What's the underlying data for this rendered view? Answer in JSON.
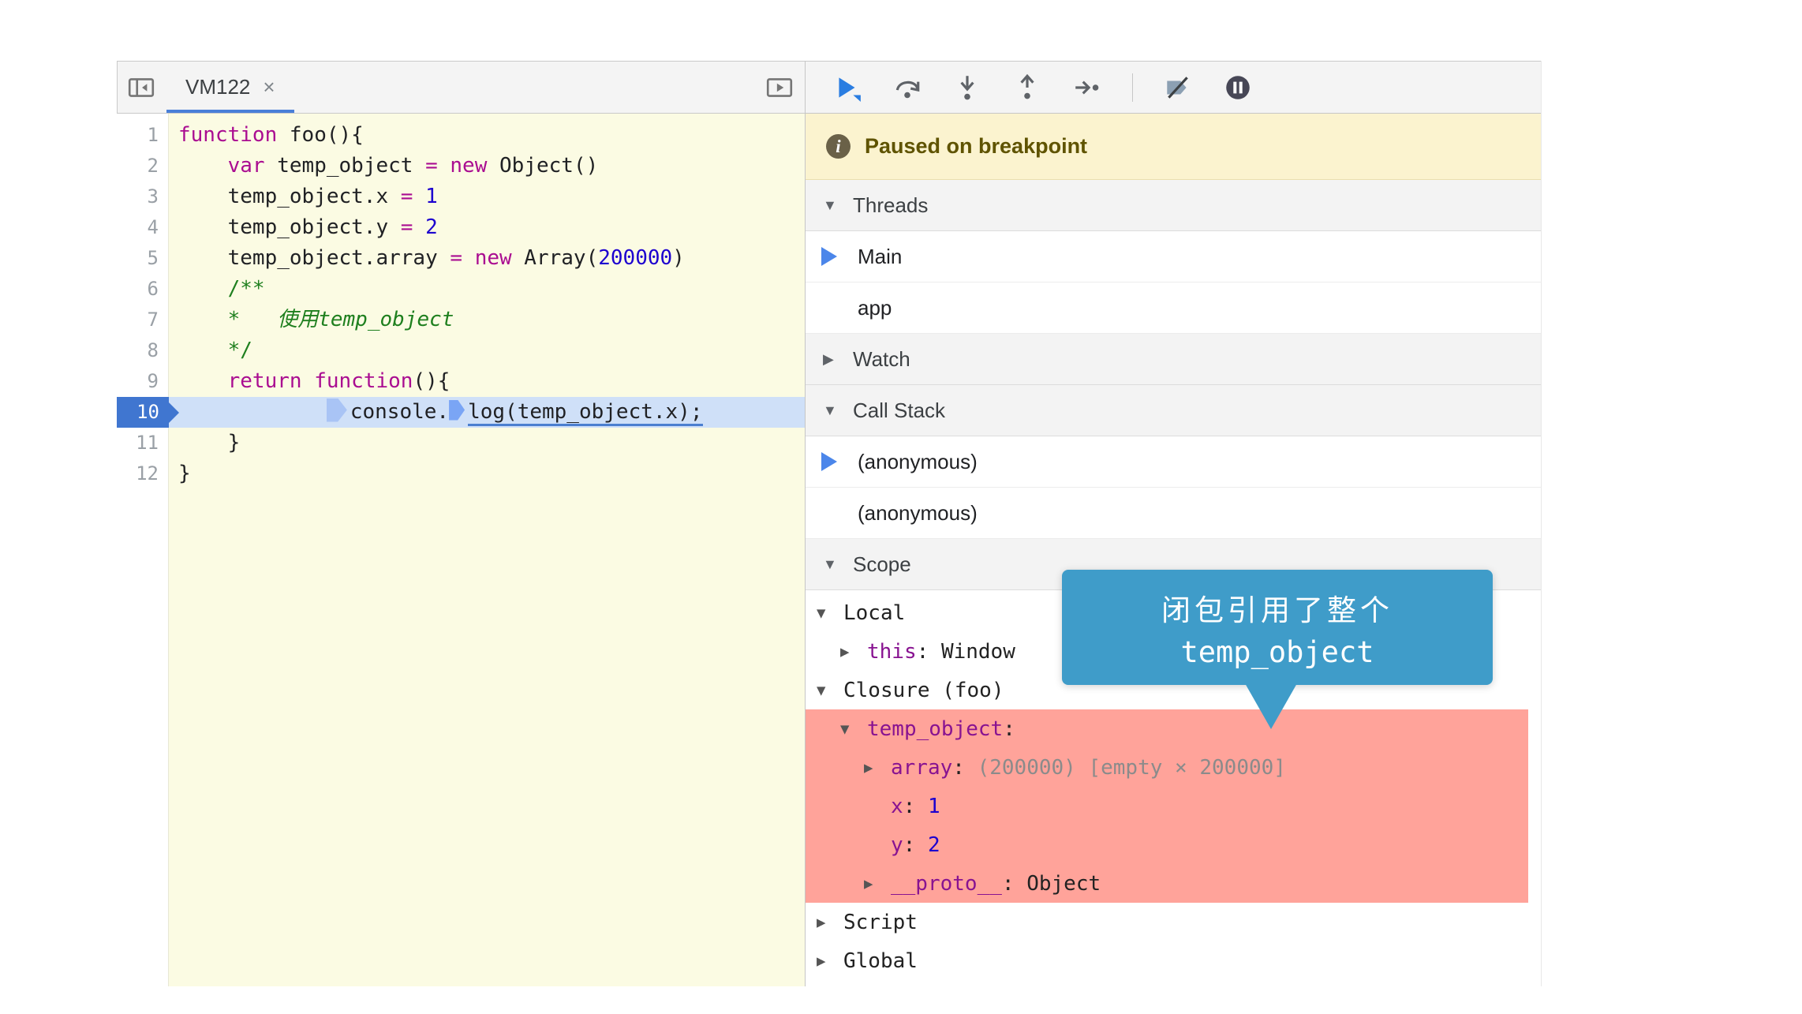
{
  "editor": {
    "tab": {
      "title": "VM122",
      "close": "×"
    },
    "icons": [
      "navigator-toggle-icon",
      "open-preview-icon"
    ],
    "lines": [
      {
        "num": "1",
        "segs": [
          [
            "kw",
            "function"
          ],
          [
            "d",
            " foo(){"
          ]
        ]
      },
      {
        "num": "2",
        "segs": [
          [
            "d",
            "    "
          ],
          [
            "kw",
            "var"
          ],
          [
            "d",
            " temp_object "
          ],
          [
            "op",
            "="
          ],
          [
            "d",
            " "
          ],
          [
            "kw",
            "new"
          ],
          [
            "d",
            " Object()"
          ]
        ]
      },
      {
        "num": "3",
        "segs": [
          [
            "d",
            "    temp_object.x "
          ],
          [
            "op",
            "="
          ],
          [
            "d",
            " "
          ],
          [
            "num",
            "1"
          ]
        ]
      },
      {
        "num": "4",
        "segs": [
          [
            "d",
            "    temp_object.y "
          ],
          [
            "op",
            "="
          ],
          [
            "d",
            " "
          ],
          [
            "num",
            "2"
          ]
        ]
      },
      {
        "num": "5",
        "segs": [
          [
            "d",
            "    temp_object.array "
          ],
          [
            "op",
            "="
          ],
          [
            "d",
            " "
          ],
          [
            "kw",
            "new"
          ],
          [
            "d",
            " Array("
          ],
          [
            "num",
            "200000"
          ],
          [
            "d",
            ")"
          ]
        ]
      },
      {
        "num": "6",
        "segs": [
          [
            "cm",
            "    /**"
          ]
        ]
      },
      {
        "num": "7",
        "segs": [
          [
            "cmi",
            "    *   使用temp_object"
          ]
        ]
      },
      {
        "num": "8",
        "segs": [
          [
            "cm",
            "    */"
          ]
        ]
      },
      {
        "num": "9",
        "segs": [
          [
            "d",
            "    "
          ],
          [
            "kw",
            "return"
          ],
          [
            "d",
            " "
          ],
          [
            "kw",
            "function"
          ],
          [
            "d",
            "(){"
          ]
        ]
      },
      {
        "num": "10",
        "current": true,
        "segs": [
          [
            "d",
            "            "
          ],
          [
            "marker-big",
            ""
          ],
          [
            "d",
            "console."
          ],
          [
            "marker",
            ""
          ],
          [
            "du",
            "log(temp_object.x);"
          ]
        ]
      },
      {
        "num": "11",
        "segs": [
          [
            "d",
            "    }"
          ]
        ]
      },
      {
        "num": "12",
        "segs": [
          [
            "d",
            "}"
          ]
        ]
      }
    ]
  },
  "debugger": {
    "toolbar_icons": [
      "resume-icon",
      "step-over-icon",
      "step-into-icon",
      "step-out-icon",
      "step-icon",
      "deactivate-breakpoints-icon",
      "pause-on-exceptions-icon"
    ],
    "banner": {
      "icon": "info-icon",
      "text": "Paused on breakpoint"
    },
    "threads": {
      "arrow": "▼",
      "label": "Threads",
      "rows": [
        {
          "label": "Main",
          "active": true
        },
        {
          "label": "app",
          "active": false
        }
      ]
    },
    "watch": {
      "arrow": "▶",
      "label": "Watch"
    },
    "call_stack": {
      "arrow": "▼",
      "label": "Call Stack",
      "rows": [
        {
          "label": "(anonymous)",
          "active": true
        },
        {
          "label": "(anonymous)",
          "active": false
        }
      ]
    },
    "scope": {
      "arrow": "▼",
      "label": "Scope",
      "rows": [
        {
          "indent": 0,
          "arrow": "▼",
          "name": "Local",
          "type": "plain"
        },
        {
          "indent": 1,
          "arrow": "▶",
          "name": "this",
          "type": "prop",
          "sep": ": ",
          "value": "Window",
          "vtype": "obj"
        },
        {
          "indent": 0,
          "arrow": "▼",
          "name": "Closure (foo)",
          "type": "plain"
        },
        {
          "indent": 1,
          "arrow": "▼",
          "name": "temp_object",
          "type": "prop",
          "sep": ":",
          "red": true
        },
        {
          "indent": 2,
          "arrow": "▶",
          "name": "array",
          "type": "prop",
          "sep": ": ",
          "value": "(200000) [empty × 200000]",
          "vtype": "grey",
          "red": true
        },
        {
          "indent": 2,
          "arrow": "",
          "name": "x",
          "type": "prop",
          "sep": ": ",
          "value": "1",
          "vtype": "num",
          "red": true
        },
        {
          "indent": 2,
          "arrow": "",
          "name": "y",
          "type": "prop",
          "sep": ": ",
          "value": "2",
          "vtype": "num",
          "red": true
        },
        {
          "indent": 2,
          "arrow": "▶",
          "name": "__proto__",
          "type": "prop",
          "sep": ": ",
          "value": "Object",
          "vtype": "obj",
          "red": true
        },
        {
          "indent": 0,
          "arrow": "▶",
          "name": "Script",
          "type": "plain"
        },
        {
          "indent": 0,
          "arrow": "▶",
          "name": "Global",
          "type": "plain"
        }
      ]
    }
  },
  "annotation": {
    "line1": "闭包引用了整个",
    "line2": "temp_object",
    "color": "#3f9cc9",
    "highlight_color": "#ffa39a"
  }
}
